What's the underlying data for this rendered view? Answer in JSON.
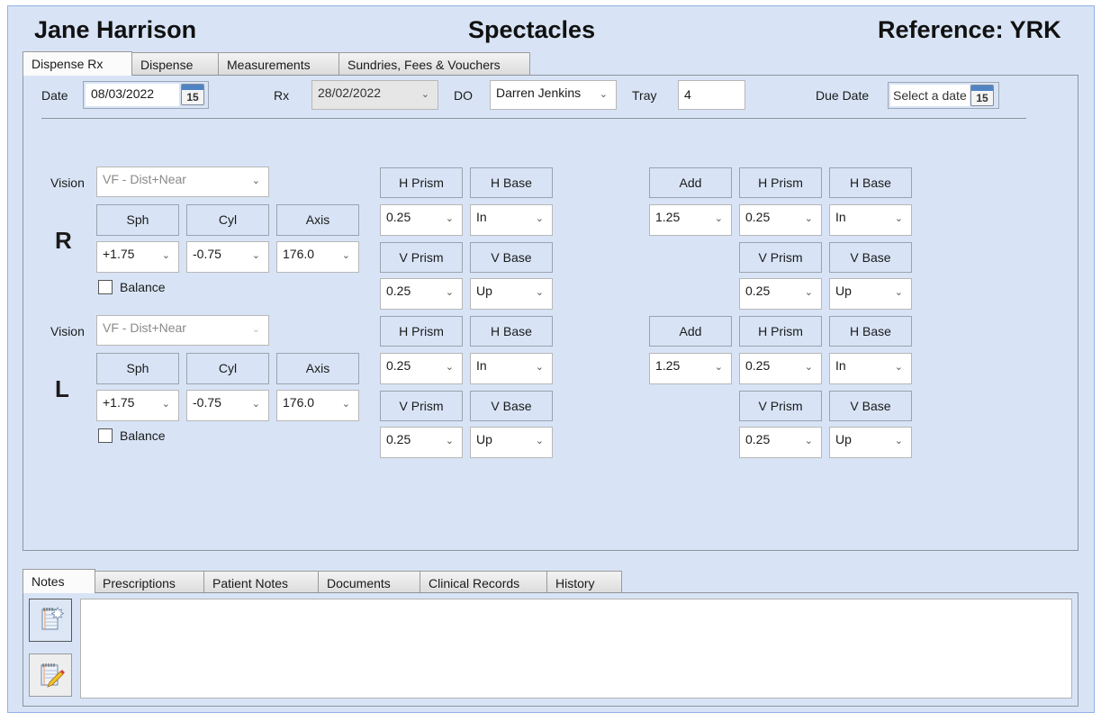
{
  "header": {
    "patient_name": "Jane Harrison",
    "title": "Spectacles",
    "reference": "Reference: YRK"
  },
  "main_tabs": [
    {
      "label": "Dispense Rx",
      "active": true
    },
    {
      "label": "Dispense",
      "active": false
    },
    {
      "label": "Measurements",
      "active": false
    },
    {
      "label": "Sundries, Fees & Vouchers",
      "active": false
    }
  ],
  "top_row": {
    "date_label": "Date",
    "date_value": "08/03/2022",
    "calendar_icon_day": "15",
    "rx_label": "Rx",
    "rx_value": "28/02/2022",
    "do_label": "DO",
    "do_value": "Darren Jenkins",
    "tray_label": "Tray",
    "tray_value": "4",
    "due_date_label": "Due Date",
    "due_date_placeholder": "Select a date"
  },
  "right_eye": {
    "eye_label": "R",
    "vision_label": "Vision",
    "vision_value": "VF - Dist+Near",
    "sph_label": "Sph",
    "sph_value": "+1.75",
    "cyl_label": "Cyl",
    "cyl_value": "-0.75",
    "axis_label": "Axis",
    "axis_value": "176.0",
    "balance_label": "Balance",
    "balance_checked": false,
    "dist": {
      "h_prism_label": "H Prism",
      "h_prism_value": "0.25",
      "h_base_label": "H Base",
      "h_base_value": "In",
      "v_prism_label": "V Prism",
      "v_prism_value": "0.25",
      "v_base_label": "V Base",
      "v_base_value": "Up"
    },
    "near": {
      "add_label": "Add",
      "add_value": "1.25",
      "h_prism_label": "H Prism",
      "h_prism_value": "0.25",
      "h_base_label": "H Base",
      "h_base_value": "In",
      "v_prism_label": "V Prism",
      "v_prism_value": "0.25",
      "v_base_label": "V Base",
      "v_base_value": "Up"
    }
  },
  "left_eye": {
    "eye_label": "L",
    "vision_label": "Vision",
    "vision_value": "VF - Dist+Near",
    "sph_label": "Sph",
    "sph_value": "+1.75",
    "cyl_label": "Cyl",
    "cyl_value": "-0.75",
    "axis_label": "Axis",
    "axis_value": "176.0",
    "balance_label": "Balance",
    "balance_checked": false,
    "dist": {
      "h_prism_label": "H Prism",
      "h_prism_value": "0.25",
      "h_base_label": "H Base",
      "h_base_value": "In",
      "v_prism_label": "V Prism",
      "v_prism_value": "0.25",
      "v_base_label": "V Base",
      "v_base_value": "Up"
    },
    "near": {
      "add_label": "Add",
      "add_value": "1.25",
      "h_prism_label": "H Prism",
      "h_prism_value": "0.25",
      "h_base_label": "H Base",
      "h_base_value": "In",
      "v_prism_label": "V Prism",
      "v_prism_value": "0.25",
      "v_base_label": "V Base",
      "v_base_value": "Up"
    }
  },
  "bottom_tabs": [
    {
      "label": "Notes",
      "active": true
    },
    {
      "label": "Prescriptions",
      "active": false
    },
    {
      "label": "Patient Notes",
      "active": false
    },
    {
      "label": "Documents",
      "active": false
    },
    {
      "label": "Clinical Records",
      "active": false
    },
    {
      "label": "History",
      "active": false
    }
  ],
  "notes": {
    "text": "",
    "buttons": [
      {
        "icon": "new-note-icon"
      },
      {
        "icon": "edit-note-icon"
      }
    ]
  },
  "colors": {
    "background": "#d8e4f6",
    "window_border": "#8eb1e6",
    "calendar_accent": "#4f84c4"
  }
}
